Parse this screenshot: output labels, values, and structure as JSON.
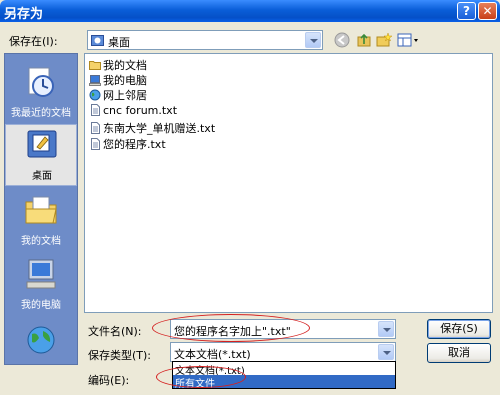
{
  "window": {
    "title": "另存为",
    "help_label": "?",
    "close_label": "✕"
  },
  "savein": {
    "label": "保存在(I):",
    "value": "桌面",
    "icon": "desktop-icon"
  },
  "toolbar": {
    "back_icon": "back-icon",
    "up_icon": "up-folder-icon",
    "newfolder_icon": "new-folder-icon",
    "views_icon": "views-menu-icon"
  },
  "places": [
    {
      "label": "我最近的文档",
      "icon": "recent-documents-icon"
    },
    {
      "label": "桌面",
      "icon": "desktop-icon"
    },
    {
      "label": "我的文档",
      "icon": "my-documents-icon"
    },
    {
      "label": "我的电脑",
      "icon": "my-computer-icon"
    },
    {
      "label": "",
      "icon": "network-places-icon"
    }
  ],
  "files": [
    {
      "name": "我的文档",
      "icon": "folder-icon"
    },
    {
      "name": "我的电脑",
      "icon": "computer-icon"
    },
    {
      "name": "网上邻居",
      "icon": "network-icon"
    },
    {
      "name": "cnc forum.txt",
      "icon": "text-file-icon"
    },
    {
      "name": "东南大学_单机赠送.txt",
      "icon": "text-file-icon"
    },
    {
      "name": "您的程序.txt",
      "icon": "text-file-icon"
    }
  ],
  "filename": {
    "label": "文件名(N):",
    "value": "您的程序名字加上\".txt\""
  },
  "filetype": {
    "label": "保存类型(T):",
    "value": "文本文档(*.txt)"
  },
  "encoding": {
    "label": "编码(E):"
  },
  "dropdown": {
    "options": [
      "文本文档(*.txt)",
      "所有文件"
    ],
    "selected": "所有文件"
  },
  "buttons": {
    "save": "保存(S)",
    "cancel": "取消"
  },
  "colors": {
    "annotation": "#D42020",
    "titlebar": "#0A5ED8",
    "selection": "#316AC5"
  }
}
